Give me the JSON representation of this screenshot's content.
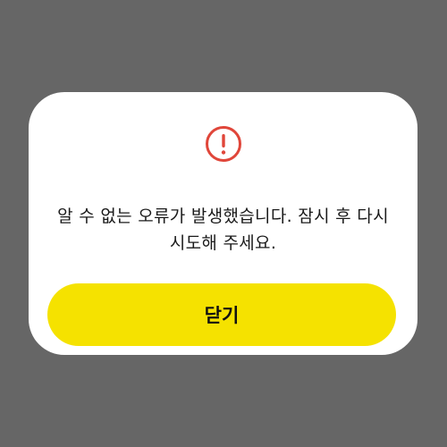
{
  "dialog": {
    "icon": "exclamation-circle-icon",
    "icon_color": "#e0463a",
    "message_line1": "알 수 없는 오류가 발생했습니다. 잠시 후 다시",
    "message_line2": "시도해 주세요.",
    "close_label": "닫기",
    "button_color": "#f5e200",
    "backdrop_color": "#666666"
  }
}
